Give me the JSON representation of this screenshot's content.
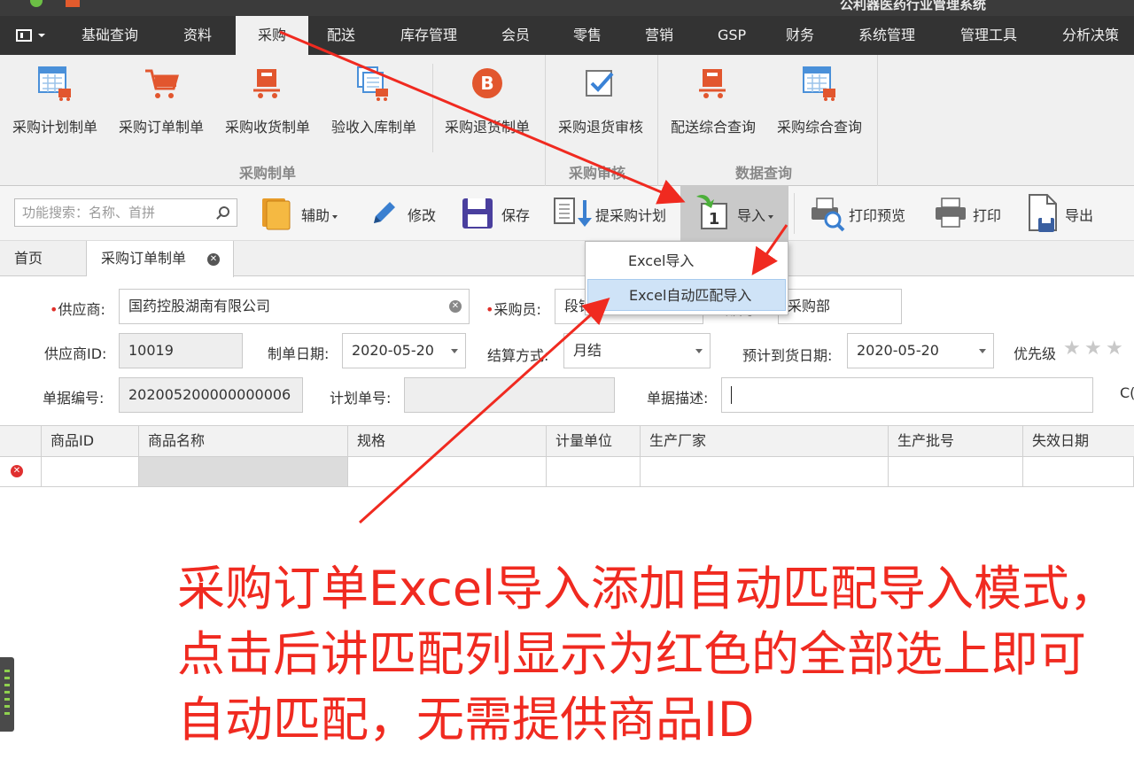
{
  "window": {
    "title": "公利器医药行业管理系统"
  },
  "menu": {
    "items": [
      "基础查询",
      "资料",
      "采购",
      "配送",
      "库存管理",
      "会员",
      "零售",
      "营销",
      "GSP",
      "财务",
      "系统管理",
      "管理工具",
      "分析决策"
    ],
    "active": "采购"
  },
  "ribbon": {
    "buttons": [
      "采购计划制单",
      "采购订单制单",
      "采购收货制单",
      "验收入库制单",
      "采购退货制单",
      "采购退货审核",
      "配送综合查询",
      "采购综合查询"
    ],
    "groups": [
      "采购制单",
      "采购审核",
      "数据查询"
    ]
  },
  "toolbar": {
    "search_placeholder": "功能搜索：名称、首拼",
    "assist": "辅助",
    "edit": "修改",
    "save": "保存",
    "extract_plan": "提采购计划",
    "import": "导入",
    "print_preview": "打印预览",
    "print": "打印",
    "export": "导出",
    "import_badge": "1"
  },
  "import_menu": {
    "items": [
      "Excel导入",
      "Excel自动匹配导入"
    ],
    "highlighted": "Excel自动匹配导入"
  },
  "tabs": [
    "首页",
    "采购订单制单"
  ],
  "form": {
    "supplier_label": "供应商:",
    "supplier": "国药控股湖南有限公司",
    "buyer_label": "采购员:",
    "buyer": "段锦",
    "dept_label": "部门:",
    "dept": "采购部",
    "supplier_id_label": "供应商ID:",
    "supplier_id": "10019",
    "made_date_label": "制单日期:",
    "made_date": "2020-05-20",
    "settle_label": "结算方式:",
    "settle": "月结",
    "arrival_label": "预计到货日期:",
    "arrival": "2020-05-20",
    "priority_label": "优先级",
    "priority_stars": 0,
    "doc_no_label": "单据编号:",
    "doc_no": "202005200000000006",
    "plan_no_label": "计划单号:",
    "plan_no": "",
    "desc_label": "单据描述:",
    "desc": "",
    "overflow_text": "C("
  },
  "grid": {
    "columns": [
      "商品ID",
      "商品名称",
      "规格",
      "计量单位",
      "生产厂家",
      "生产批号",
      "失效日期"
    ],
    "rows": [
      [
        "",
        "",
        "",
        "",
        "",
        "",
        ""
      ]
    ]
  },
  "annotation": "采购订单Excel导入添加自动匹配导入模式，点击后讲匹配列显示为红色的全部选上即可自动匹配，无需提供商品ID",
  "colors": {
    "menubar": "#333333",
    "ribbon": "#f0f0f0",
    "annotation": "#f02a20",
    "highlight": "#cfe3f7",
    "required": "#e0302a"
  }
}
